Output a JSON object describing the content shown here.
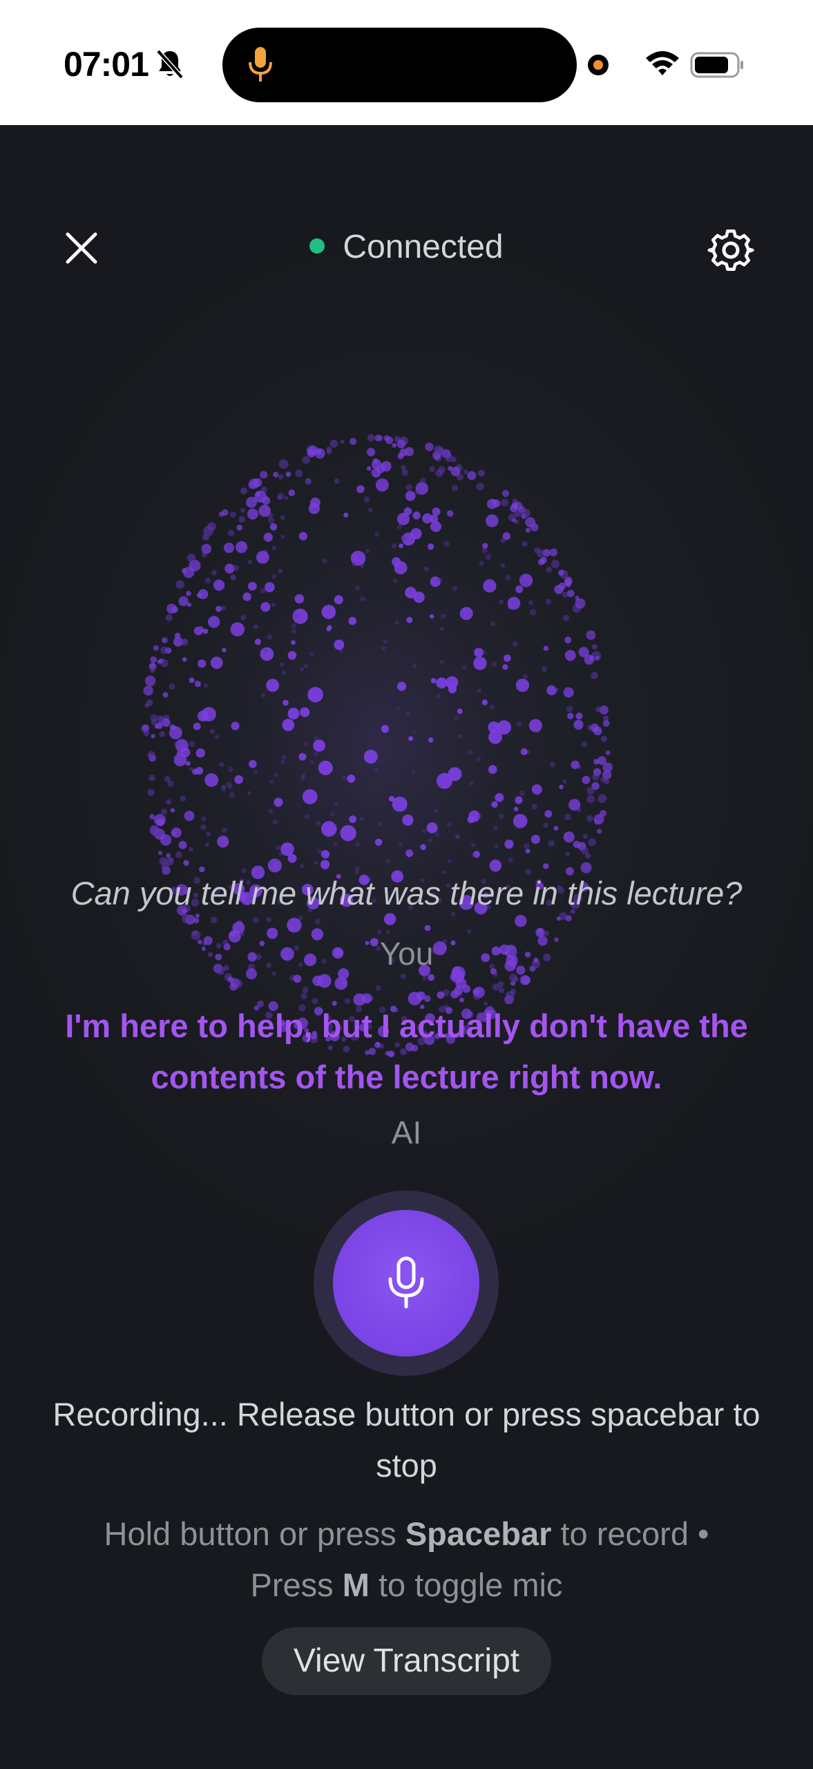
{
  "status_bar": {
    "time": "07:01",
    "icons": [
      "bell-off-icon",
      "mic-icon",
      "recording-dot-icon",
      "wifi-icon",
      "battery-icon"
    ],
    "accent_mic_color": "#f2a23a"
  },
  "header": {
    "status_text": "Connected",
    "status_color": "#1fbf86",
    "close_icon": "close-icon",
    "settings_icon": "gear-icon"
  },
  "conversation": {
    "user_message": "Can you tell me what was there in this lecture?",
    "user_label": "You",
    "ai_message": "I'm here to help, but I actually don't have the contents of the lecture right now.",
    "ai_label": "AI",
    "ai_color": "#a455f0"
  },
  "controls": {
    "mic_icon": "mic-icon",
    "recording_status": "Recording... Release button or press spacebar to stop",
    "hint": {
      "part1": "Hold button or press ",
      "key1": "Spacebar",
      "part2": " to record • Press ",
      "key2": "M",
      "part3": " to toggle mic"
    },
    "transcript_button": "View Transcript",
    "accent_color": "#7a44e6"
  }
}
